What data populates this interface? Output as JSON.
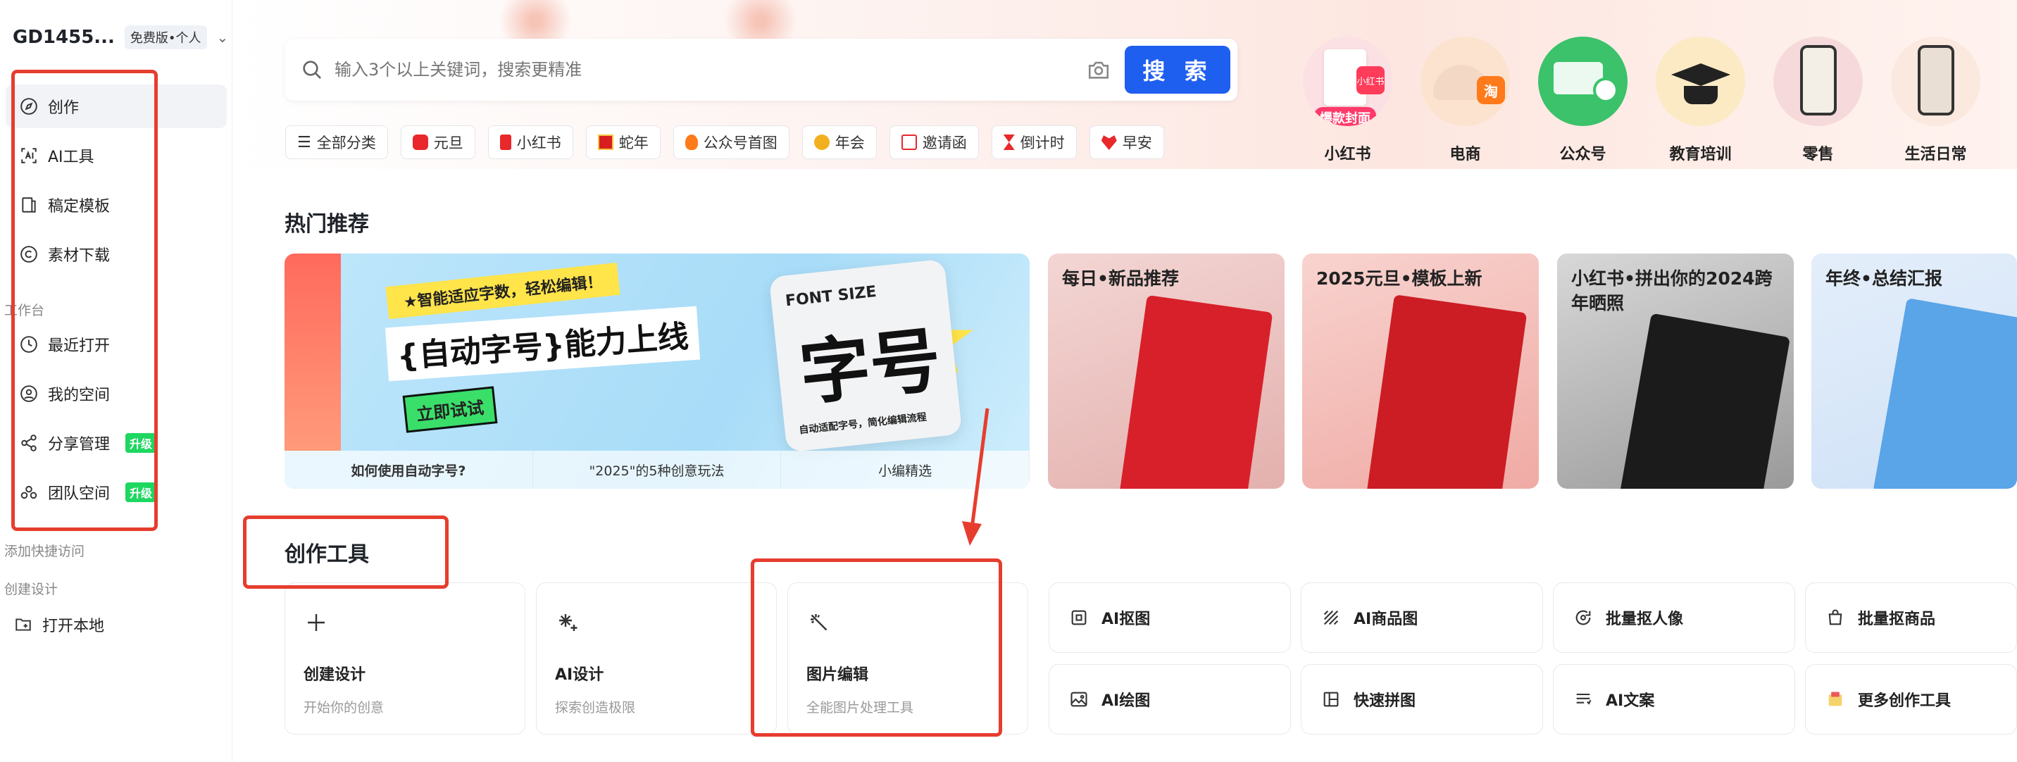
{
  "account": {
    "name": "GD1455...",
    "plan": "免费版•个人"
  },
  "nav": {
    "create": "创作",
    "ai_tools": "AI工具",
    "templates": "稿定模板",
    "assets": "素材下载",
    "workspace_label": "工作台",
    "recent": "最近打开",
    "my_space": "我的空间",
    "share": "分享管理",
    "team": "团队空间",
    "upgrade": "升级",
    "quick_access": "添加快捷访问",
    "create_design_label": "创建设计",
    "open_local": "打开本地"
  },
  "search": {
    "placeholder": "输入3个以上关键词，搜索更精准",
    "button": "搜 索"
  },
  "chips": [
    "全部分类",
    "元旦",
    "小红书",
    "蛇年",
    "公众号首图",
    "年会",
    "邀请函",
    "倒计时",
    "早安"
  ],
  "categories": [
    "小红书",
    "电商",
    "公众号",
    "教育培训",
    "零售",
    "生活日常"
  ],
  "cat_tags": {
    "hot": "爆款封面",
    "xhs": "小红书",
    "tao": "淘"
  },
  "hot": {
    "title": "热门推荐",
    "banner": {
      "tagline": "★智能适应字数，轻松编辑！",
      "headline": "{自动字号}能力上线",
      "try": "立即试试",
      "card_fs": "FONT SIZE",
      "card_big": "字号",
      "card_sub": "自动适配字号，简化编辑流程",
      "tabs": [
        "如何使用自动字号?",
        "\"2025\"的5种创意玩法",
        "小编精选"
      ]
    },
    "tiles": [
      "每日•新品推荐",
      "2025元旦•模板上新",
      "小红书•拼出你的2024跨年晒照",
      "年终•总结汇报"
    ]
  },
  "tools": {
    "title": "创作工具",
    "big": [
      {
        "name": "创建设计",
        "desc": "开始你的创意"
      },
      {
        "name": "AI设计",
        "desc": "探索创造极限"
      },
      {
        "name": "图片编辑",
        "desc": "全能图片处理工具"
      }
    ],
    "small": [
      "AI抠图",
      "AI商品图",
      "批量抠人像",
      "批量抠商品",
      "AI绘图",
      "快速拼图",
      "AI文案",
      "更多创作工具"
    ]
  },
  "colors": {
    "accent": "#1f5fef",
    "annotation": "#e63d2e",
    "upgrade": "#1ed760"
  }
}
